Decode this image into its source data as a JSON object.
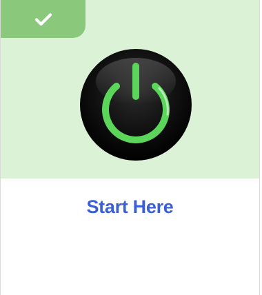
{
  "card": {
    "title": "Start Here",
    "status": "completed",
    "badge_icon": "checkmark-icon",
    "hero_icon": "power-icon"
  },
  "colors": {
    "hero_background": "#dcf2d6",
    "badge_background": "#8ac97b",
    "power_ring": "#5bd65b",
    "power_button": "#0b0b0b",
    "title_text": "#3b5fd6"
  }
}
